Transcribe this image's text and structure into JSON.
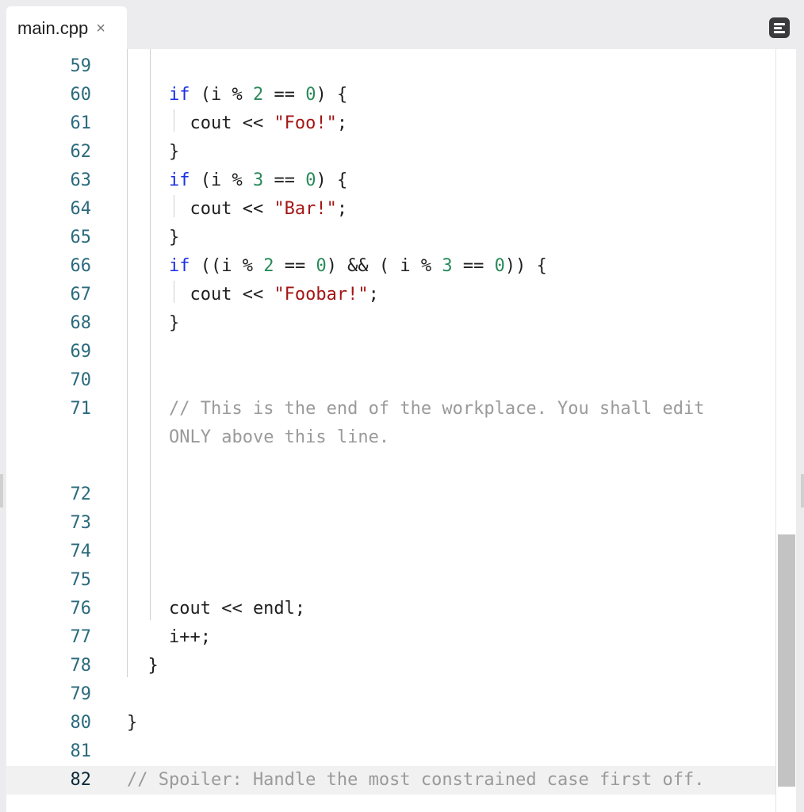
{
  "tab": {
    "label": "main.cpp",
    "close_glyph": "×"
  },
  "toolbar": {
    "panel_icon": "panel-menu-icon"
  },
  "colors": {
    "keyword": "#1a2ee6",
    "number": "#2a8a5a",
    "string": "#a31515",
    "comment": "#9a9a9a",
    "line_number": "#2b6a7d",
    "current_line_bg": "#f1f1f2"
  },
  "editor": {
    "current_line": "82",
    "lines": [
      {
        "num": "59",
        "tokens": []
      },
      {
        "num": "60",
        "tokens": [
          {
            "t": "    "
          },
          {
            "t": "if",
            "c": "kw"
          },
          {
            "t": " (i % "
          },
          {
            "t": "2",
            "c": "num"
          },
          {
            "t": " == "
          },
          {
            "t": "0",
            "c": "num"
          },
          {
            "t": ") {"
          }
        ]
      },
      {
        "num": "61",
        "tokens": [
          {
            "t": "      cout << "
          },
          {
            "t": "\"Foo!\"",
            "c": "str"
          },
          {
            "t": ";"
          }
        ]
      },
      {
        "num": "62",
        "tokens": [
          {
            "t": "    }"
          }
        ]
      },
      {
        "num": "63",
        "tokens": [
          {
            "t": "    "
          },
          {
            "t": "if",
            "c": "kw"
          },
          {
            "t": " (i % "
          },
          {
            "t": "3",
            "c": "num"
          },
          {
            "t": " == "
          },
          {
            "t": "0",
            "c": "num"
          },
          {
            "t": ") {"
          }
        ]
      },
      {
        "num": "64",
        "tokens": [
          {
            "t": "      cout << "
          },
          {
            "t": "\"Bar!\"",
            "c": "str"
          },
          {
            "t": ";"
          }
        ]
      },
      {
        "num": "65",
        "tokens": [
          {
            "t": "    }"
          }
        ]
      },
      {
        "num": "66",
        "tokens": [
          {
            "t": "    "
          },
          {
            "t": "if",
            "c": "kw"
          },
          {
            "t": " ((i % "
          },
          {
            "t": "2",
            "c": "num"
          },
          {
            "t": " == "
          },
          {
            "t": "0",
            "c": "num"
          },
          {
            "t": ") && ( i % "
          },
          {
            "t": "3",
            "c": "num"
          },
          {
            "t": " == "
          },
          {
            "t": "0",
            "c": "num"
          },
          {
            "t": ")) {"
          }
        ]
      },
      {
        "num": "67",
        "tokens": [
          {
            "t": "      cout << "
          },
          {
            "t": "\"Foobar!\"",
            "c": "str"
          },
          {
            "t": ";"
          }
        ]
      },
      {
        "num": "68",
        "tokens": [
          {
            "t": "    }"
          }
        ]
      },
      {
        "num": "69",
        "tokens": []
      },
      {
        "num": "70",
        "tokens": []
      },
      {
        "num": "71",
        "tokens": [
          {
            "t": "    "
          },
          {
            "t": "// This is the end of the workplace. You shall edit",
            "c": "cmt"
          }
        ]
      },
      {
        "num": "",
        "tokens": [
          {
            "t": "    "
          },
          {
            "t": "ONLY above this line.",
            "c": "cmt"
          }
        ]
      },
      {
        "num": "",
        "tokens": []
      },
      {
        "num": "72",
        "tokens": []
      },
      {
        "num": "73",
        "tokens": []
      },
      {
        "num": "74",
        "tokens": []
      },
      {
        "num": "75",
        "tokens": []
      },
      {
        "num": "76",
        "tokens": [
          {
            "t": "    cout << endl;"
          }
        ]
      },
      {
        "num": "77",
        "tokens": [
          {
            "t": "    i++;"
          }
        ]
      },
      {
        "num": "78",
        "tokens": [
          {
            "t": "  }"
          }
        ]
      },
      {
        "num": "79",
        "tokens": []
      },
      {
        "num": "80",
        "tokens": [
          {
            "t": "}"
          }
        ]
      },
      {
        "num": "81",
        "tokens": []
      },
      {
        "num": "82",
        "tokens": [
          {
            "t": "// Spoiler: Handle the most constrained case first off.",
            "c": "cmt"
          }
        ]
      }
    ]
  }
}
